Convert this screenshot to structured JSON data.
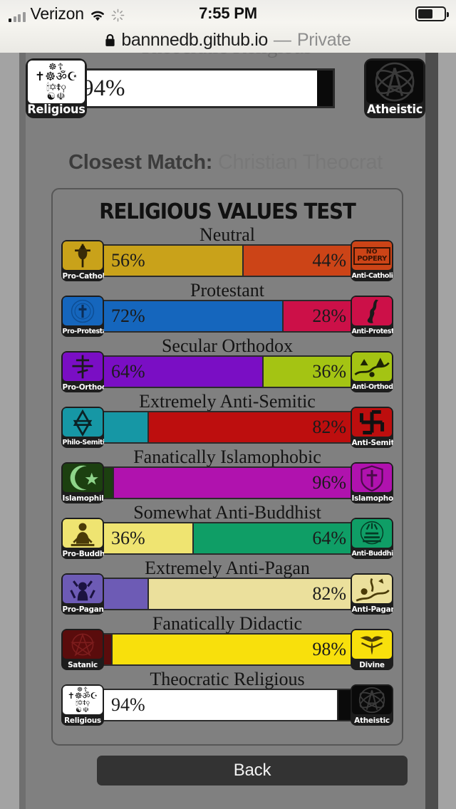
{
  "status_bar": {
    "carrier": "Verizon",
    "time": "7:55 PM",
    "wifi_icon": "wifi-icon",
    "spinner_icon": "activity-spinner-icon",
    "battery_icon": "battery-icon",
    "signal_icon": "cellular-signal-icon"
  },
  "url_bar": {
    "lock_icon": "lock-icon",
    "host": "bannnedb.github.io",
    "separator": "—",
    "mode": "Private"
  },
  "top_result": {
    "cut_label": "Theocratic Religious",
    "left_caption": "Religious",
    "right_caption": "Atheistic",
    "left_percent": "94%",
    "left_value": 94,
    "right_value": 6,
    "left_color": "#ffffff",
    "right_color": "#0a0a0a",
    "left_icon": "religious-symbols-icon",
    "right_icon": "atheist-atom-icon"
  },
  "closest_match": {
    "key": "Closest Match:",
    "value": "Christian Theocrat"
  },
  "card": {
    "title": "RELIGIOUS VALUES TEST",
    "back_label": "Back"
  },
  "chart_data": {
    "type": "bar",
    "title": "RELIGIOUS VALUES TEST",
    "xlabel": "",
    "ylabel": "",
    "xlim": [
      0,
      100
    ],
    "grid": false,
    "legend": "none",
    "note": "Horizontal diverging 100% stacked bars; each row is one opposed axis with a verdict label above.",
    "rows": [
      {
        "verdict": "Neutral",
        "left_label": "Pro-Catholic",
        "right_label": "Anti-Catholic",
        "left_value": 56,
        "right_value": 44,
        "left_text": "56%",
        "right_text": "44%",
        "left_color": "#c9a21a",
        "right_color": "#cc4417",
        "left_icon": "crucifix-icon",
        "right_icon": "no-popery-sign-icon"
      },
      {
        "verdict": "Protestant",
        "left_label": "Pro-Protestant",
        "right_label": "Anti-Protestant",
        "left_value": 72,
        "right_value": 28,
        "left_text": "72%",
        "right_text": "28%",
        "left_color": "#1566bd",
        "right_color": "#cc1048",
        "left_icon": "protestant-seal-icon",
        "right_icon": "anti-protestant-figure-icon"
      },
      {
        "verdict": "Secular Orthodox",
        "left_label": "Pro-Orthodox",
        "right_label": "Anti-Orthodox",
        "left_value": 64,
        "right_value": 36,
        "left_text": "64%",
        "right_text": "36%",
        "left_color": "#7a0ec4",
        "right_color": "#a4c413",
        "left_icon": "orthodox-cross-icon",
        "right_icon": "anti-orthodox-scene-icon"
      },
      {
        "verdict": "Extremely Anti-Semitic",
        "left_label": "Philo-Semitic",
        "right_label": "Anti-Semitic",
        "left_value": 18,
        "right_value": 82,
        "left_text": "",
        "right_text": "82%",
        "left_color": "#1697a5",
        "right_color": "#bd0e0e",
        "left_icon": "star-of-david-icon",
        "right_icon": "swastika-icon"
      },
      {
        "verdict": "Fanatically Islamophobic",
        "left_label": "Islamophilic",
        "right_label": "Islamophobic",
        "left_value": 4,
        "right_value": 96,
        "left_text": "",
        "right_text": "96%",
        "left_color": "#1c4010",
        "right_color": "#b012ae",
        "left_icon": "star-and-crescent-icon",
        "right_icon": "crusader-shield-icon"
      },
      {
        "verdict": "Somewhat Anti-Buddhist",
        "left_label": "Pro-Buddhist",
        "right_label": "Anti-Buddhist",
        "left_value": 36,
        "right_value": 64,
        "left_text": "36%",
        "right_text": "64%",
        "left_color": "#efe471",
        "right_color": "#0f9e66",
        "left_icon": "buddha-statue-icon",
        "right_icon": "anti-buddhist-scene-icon"
      },
      {
        "verdict": "Extremely Anti-Pagan",
        "left_label": "Pro-Pagan",
        "right_label": "Anti-Pagan",
        "left_value": 18,
        "right_value": 82,
        "left_text": "",
        "right_text": "82%",
        "left_color": "#6d5bb5",
        "right_color": "#ebe09c",
        "left_icon": "horned-idol-icon",
        "right_icon": "anti-pagan-scene-icon"
      },
      {
        "verdict": "Fanatically Didactic",
        "left_label": "Satanic",
        "right_label": "Divine",
        "left_value": 2,
        "right_value": 98,
        "left_text": "",
        "right_text": "98%",
        "left_color": "#5a0c0c",
        "right_color": "#f8e00c",
        "left_icon": "pentagram-icon",
        "right_icon": "divine-eagle-icon"
      },
      {
        "verdict": "Theocratic Religious",
        "left_label": "Religious",
        "right_label": "Atheistic",
        "left_value": 94,
        "right_value": 6,
        "left_text": "94%",
        "right_text": "",
        "left_color": "#ffffff",
        "right_color": "#0a0a0a",
        "left_icon": "religious-symbols-icon",
        "right_icon": "atheist-atom-icon"
      }
    ]
  }
}
